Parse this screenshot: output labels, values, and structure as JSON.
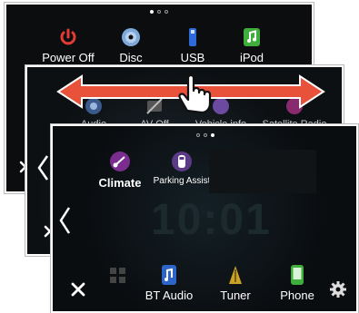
{
  "screen1": {
    "page_dots": 3,
    "active_dot": 0,
    "tiles": [
      {
        "label": "Power Off",
        "icon": "power-icon"
      },
      {
        "label": "Disc",
        "icon": "disc-icon"
      },
      {
        "label": "USB",
        "icon": "usb-icon"
      },
      {
        "label": "iPod",
        "icon": "ipod-music-icon"
      }
    ]
  },
  "screen2": {
    "tiles": [
      {
        "label": "Audio",
        "icon": "audio-icon"
      },
      {
        "label": "AV Off",
        "icon": "av-off-icon"
      },
      {
        "label": "Vehicle info",
        "icon": "vehicle-info-icon"
      },
      {
        "label": "Satellite Radio",
        "icon": "satellite-radio-icon"
      }
    ]
  },
  "screen3": {
    "page_dots": 3,
    "active_dot": 2,
    "clock": "10:01",
    "top_tiles": [
      {
        "label": "Climate",
        "icon": "climate-icon"
      },
      {
        "label": "Parking Assist",
        "icon": "parking-assist-icon"
      }
    ],
    "dock_tiles": [
      {
        "label": "BT Audio",
        "icon": "bt-audio-icon"
      },
      {
        "label": "Tuner",
        "icon": "tuner-icon"
      },
      {
        "label": "Phone",
        "icon": "phone-icon"
      }
    ]
  },
  "gesture": {
    "arrow": "double-headed-arrow",
    "hand": "swipe-hand-icon"
  },
  "colors": {
    "arrow": "#e8513a",
    "power": "#e23b34",
    "usb": "#2f6bd8",
    "ipod": "#3fae3c"
  }
}
